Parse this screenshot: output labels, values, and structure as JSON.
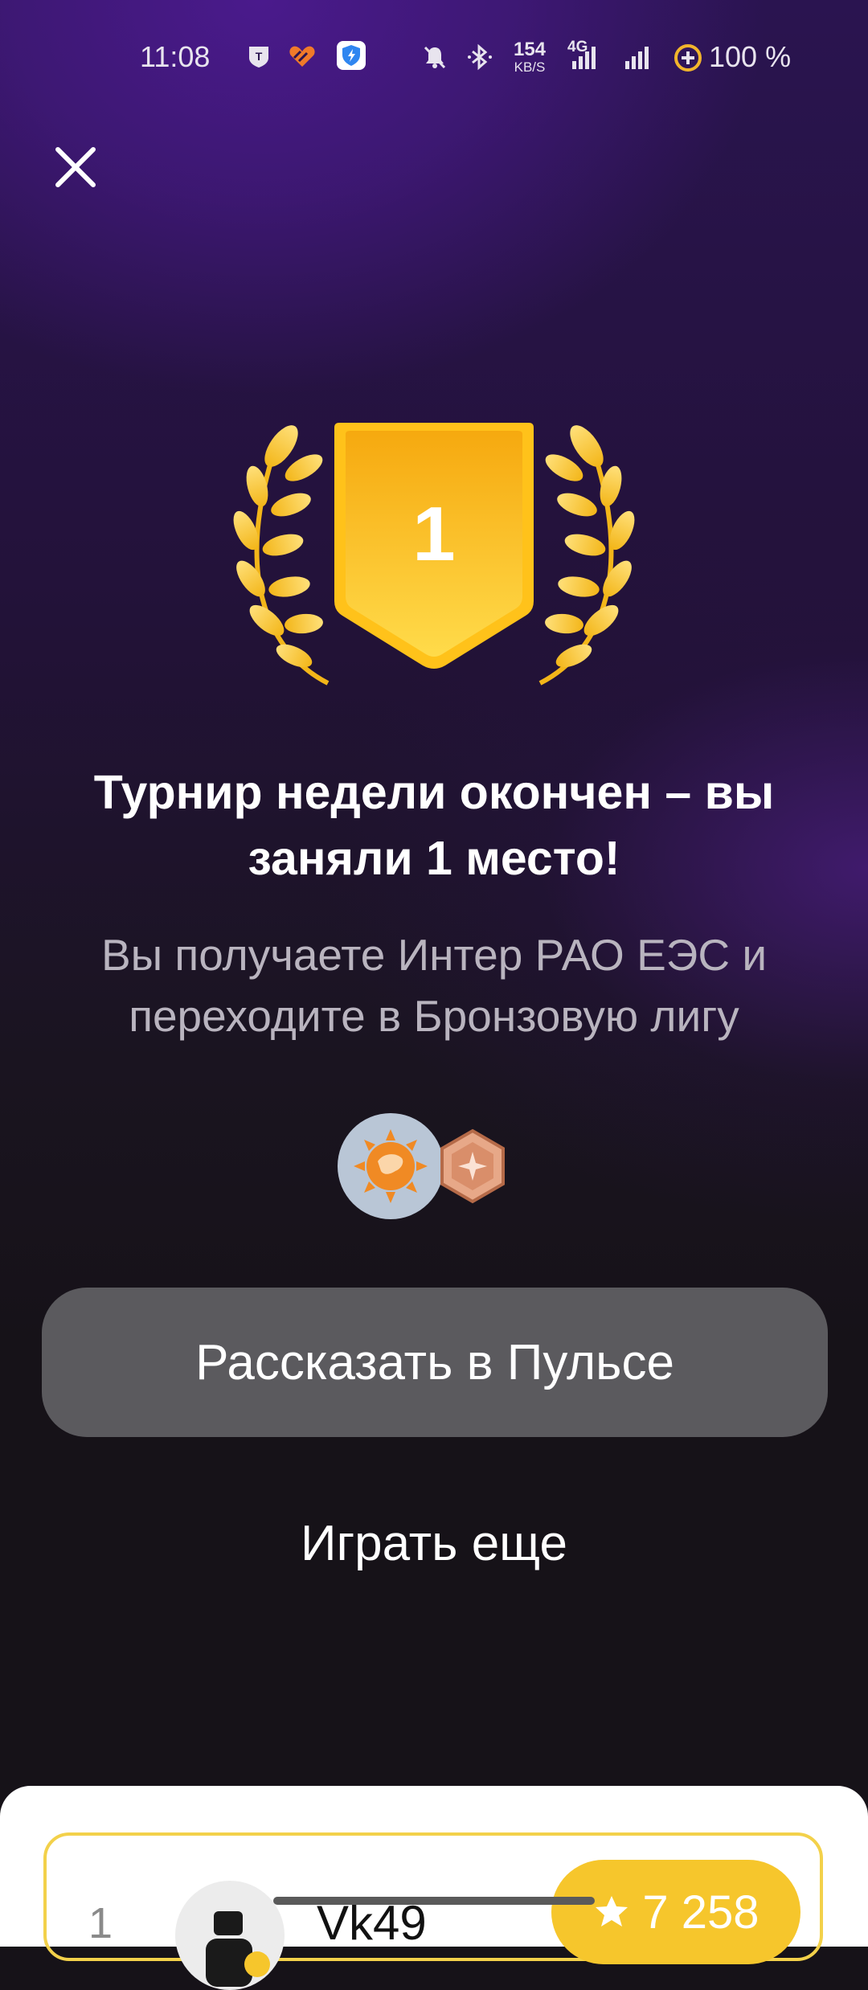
{
  "status_bar": {
    "time": "11:08",
    "net_speed_value": "154",
    "net_speed_unit": "KB/S",
    "network_type": "4G",
    "battery": "100 %"
  },
  "result": {
    "place_number": "1",
    "title": "Турнир недели окончен – вы заняли 1 место!",
    "subtitle": "Вы получаете Интер РАО ЕЭС и переходите в Бронзовую лигу"
  },
  "actions": {
    "share_label": "Рассказать в Пульсе",
    "play_again_label": "Играть еще"
  },
  "leaderboard": {
    "rows": [
      {
        "rank": "1",
        "username": "Vk49",
        "score": "7 258"
      }
    ]
  },
  "colors": {
    "gold": "#f6c62c",
    "purple": "#4a1a8c",
    "button_gray": "#5b5a5e",
    "bronze": "#d99a78"
  }
}
